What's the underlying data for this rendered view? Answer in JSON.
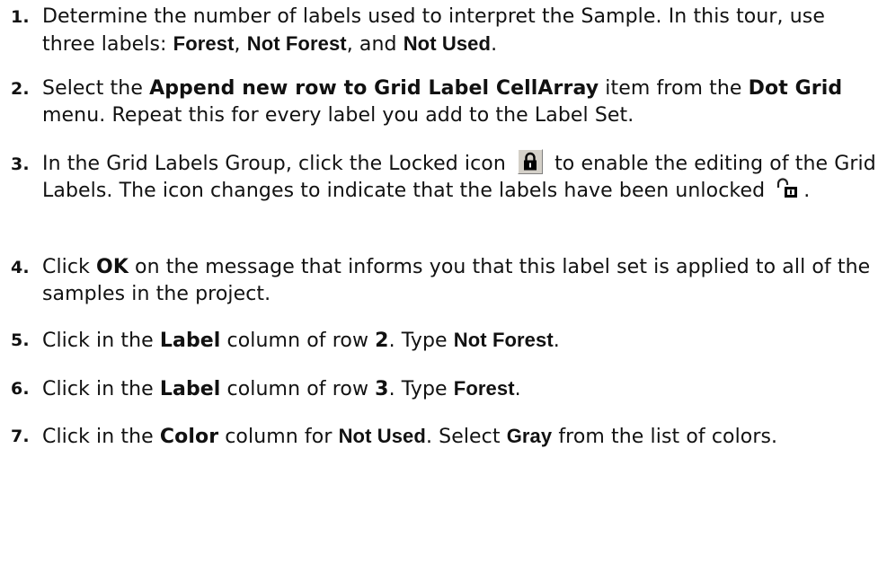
{
  "steps": [
    {
      "num": "1.",
      "parts": [
        {
          "t": "Determine the number of labels used to interpret the Sample. In this tour, use three labels: "
        },
        {
          "t": "Forest",
          "b": "a"
        },
        {
          "t": ", "
        },
        {
          "t": "Not Forest",
          "b": "a"
        },
        {
          "t": ", and "
        },
        {
          "t": "Not Used",
          "b": "a"
        },
        {
          "t": "."
        }
      ]
    },
    {
      "num": "2.",
      "parts": [
        {
          "t": "Select the "
        },
        {
          "t": "Append new row to Grid Label CellArray",
          "b": "v"
        },
        {
          "t": " item from the "
        },
        {
          "t": "Dot Grid",
          "b": "v"
        },
        {
          "t": " menu. Repeat this for every label you add to the Label Set."
        }
      ]
    },
    {
      "num": "3.",
      "parts": [
        {
          "t": "In the Grid Labels Group, click the Locked icon "
        },
        {
          "icon": "lock-icon"
        },
        {
          "t": " to enable the editing of the Grid Labels. The icon changes to indicate that the labels have been unlocked "
        },
        {
          "icon": "unlock-icon"
        },
        {
          "t": "."
        }
      ]
    },
    {
      "num": "4.",
      "parts": [
        {
          "t": "Click "
        },
        {
          "t": "OK",
          "b": "v"
        },
        {
          "t": " on the message that informs you that this label set is applied to all of the samples in the project."
        }
      ]
    },
    {
      "num": "5.",
      "parts": [
        {
          "t": "Click in the "
        },
        {
          "t": "Label",
          "b": "v"
        },
        {
          "t": " column of row "
        },
        {
          "t": "2",
          "b": "v"
        },
        {
          "t": ". Type "
        },
        {
          "t": "Not Forest",
          "b": "a"
        },
        {
          "t": "."
        }
      ]
    },
    {
      "num": "6.",
      "parts": [
        {
          "t": "Click in the "
        },
        {
          "t": "Label",
          "b": "v"
        },
        {
          "t": " column of row "
        },
        {
          "t": "3",
          "b": "v"
        },
        {
          "t": ". Type "
        },
        {
          "t": "Forest",
          "b": "a"
        },
        {
          "t": "."
        }
      ]
    },
    {
      "num": "7.",
      "parts": [
        {
          "t": "Click in the "
        },
        {
          "t": "Color",
          "b": "v"
        },
        {
          "t": " column for "
        },
        {
          "t": "Not Used",
          "b": "a"
        },
        {
          "t": ". Select "
        },
        {
          "t": "Gray",
          "b": "a"
        },
        {
          "t": " from the list of colors."
        }
      ]
    }
  ],
  "colors": {
    "text": "#111111",
    "icon_face": "#d4d0c8",
    "lock_body": "#000000"
  }
}
